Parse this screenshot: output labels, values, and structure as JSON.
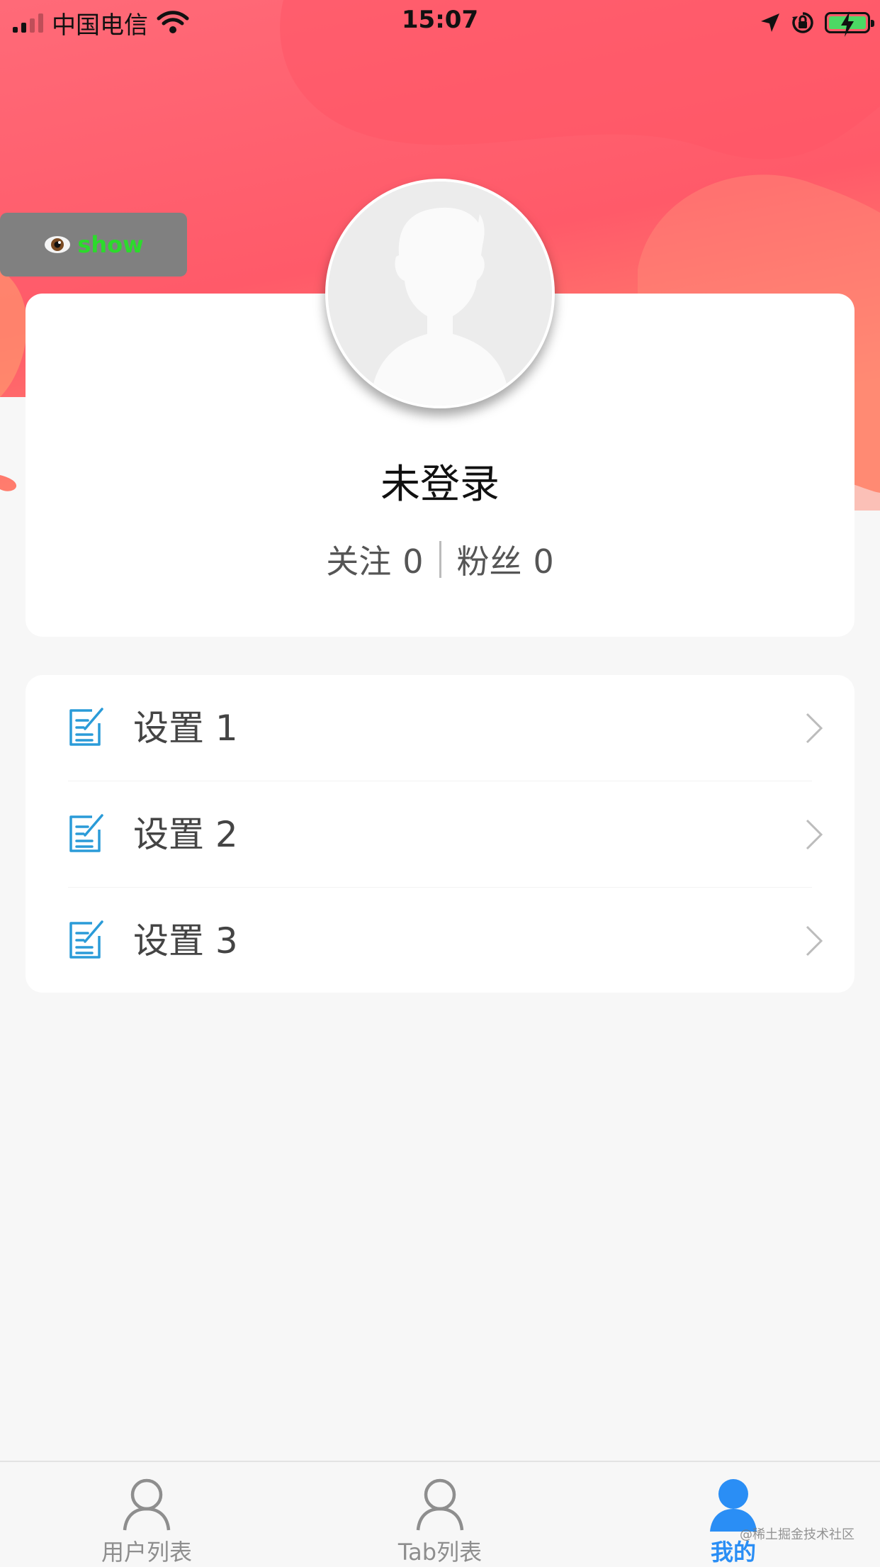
{
  "status_bar": {
    "carrier": "中国电信",
    "time": "15:07"
  },
  "colors": {
    "hero_gradient": [
      "#ff5a69",
      "#ff8a6f"
    ],
    "tab_active": "#2a8ef5",
    "tab_inactive": "#8e8e8e",
    "icon_blue": "#2a9bd8",
    "show_label": "#2bdb2b"
  },
  "debug_button": {
    "icon": "eye-icon",
    "label": "show"
  },
  "profile": {
    "name": "未登录",
    "avatar_icon": "default-avatar-icon",
    "following_label": "关注",
    "following_count": "0",
    "followers_label": "粉丝",
    "followers_count": "0"
  },
  "settings": [
    {
      "label": "设置 1",
      "icon": "edit-document-icon"
    },
    {
      "label": "设置 2",
      "icon": "edit-document-icon"
    },
    {
      "label": "设置 3",
      "icon": "edit-document-icon"
    }
  ],
  "tab_bar": {
    "tabs": [
      {
        "label": "用户列表",
        "icon": "user-outline-icon",
        "active": false
      },
      {
        "label": "Tab列表",
        "icon": "user-outline-icon",
        "active": false
      },
      {
        "label": "我的",
        "icon": "user-filled-icon",
        "active": true
      }
    ]
  },
  "watermark": "@稀土掘金技术社区"
}
